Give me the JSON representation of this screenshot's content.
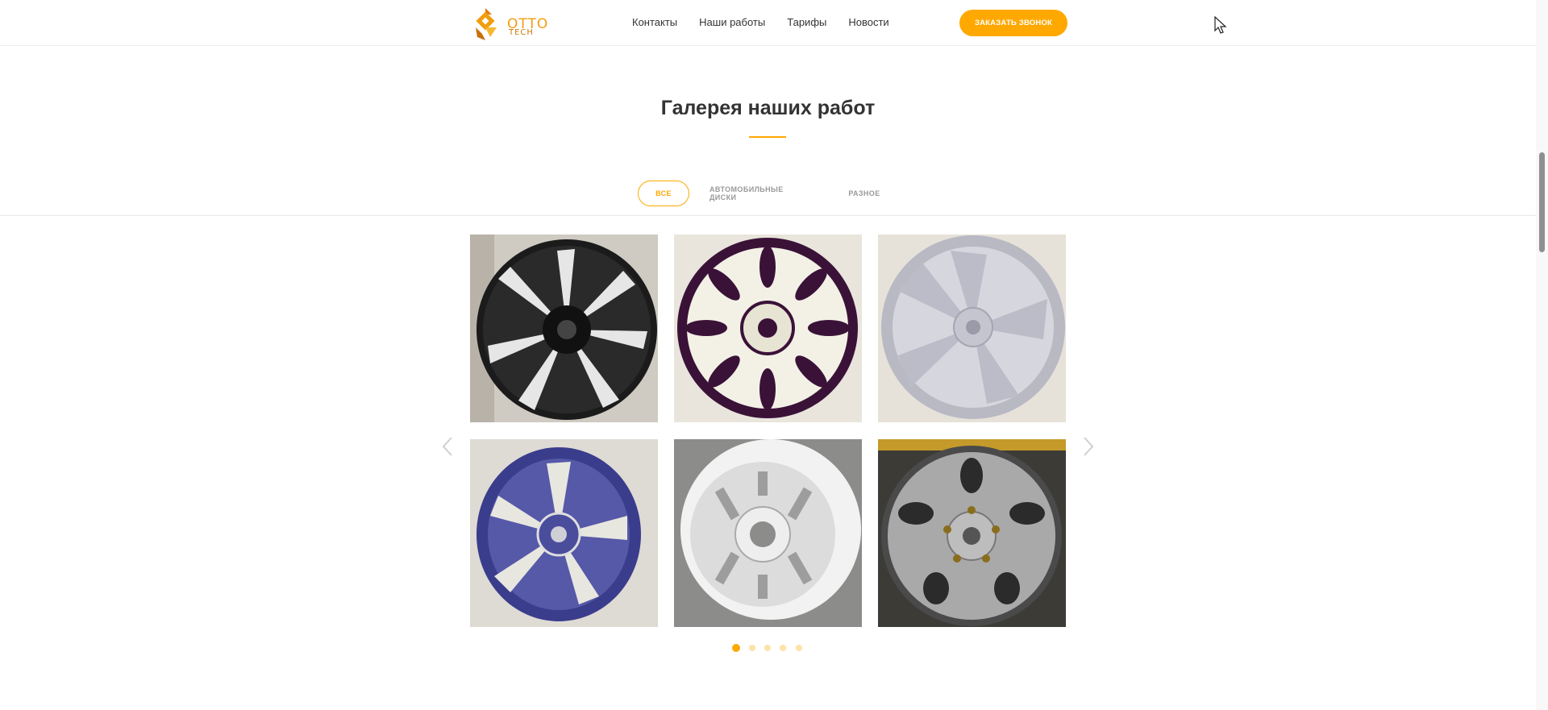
{
  "header": {
    "logo": {
      "text_top": "OTTO",
      "text_bottom": "TECH",
      "accent_color": "#f29d0e"
    },
    "nav": [
      {
        "label": "Контакты"
      },
      {
        "label": "Наши работы"
      },
      {
        "label": "Тарифы"
      },
      {
        "label": "Новости"
      }
    ],
    "call_button": "ЗАКАЗАТЬ ЗВОНОК"
  },
  "gallery": {
    "title": "Галерея наших работ",
    "filters": [
      {
        "label": "ВСЕ",
        "active": true
      },
      {
        "label": "АВТОМОБИЛЬНЫЕ ДИСКИ",
        "active": false
      },
      {
        "label": "РАЗНОЕ",
        "active": false
      }
    ],
    "items": [
      {
        "icon": "wheel-black-silver"
      },
      {
        "icon": "wheel-purple-white"
      },
      {
        "icon": "wheel-grey-primer"
      },
      {
        "icon": "wheel-purple-silver"
      },
      {
        "icon": "wheel-white-steel"
      },
      {
        "icon": "wheel-silver-chrome"
      }
    ],
    "pagination": {
      "pages": 5,
      "current": 1
    }
  },
  "colors": {
    "accent": "#ffa800",
    "text": "#333333",
    "muted": "#999999"
  }
}
